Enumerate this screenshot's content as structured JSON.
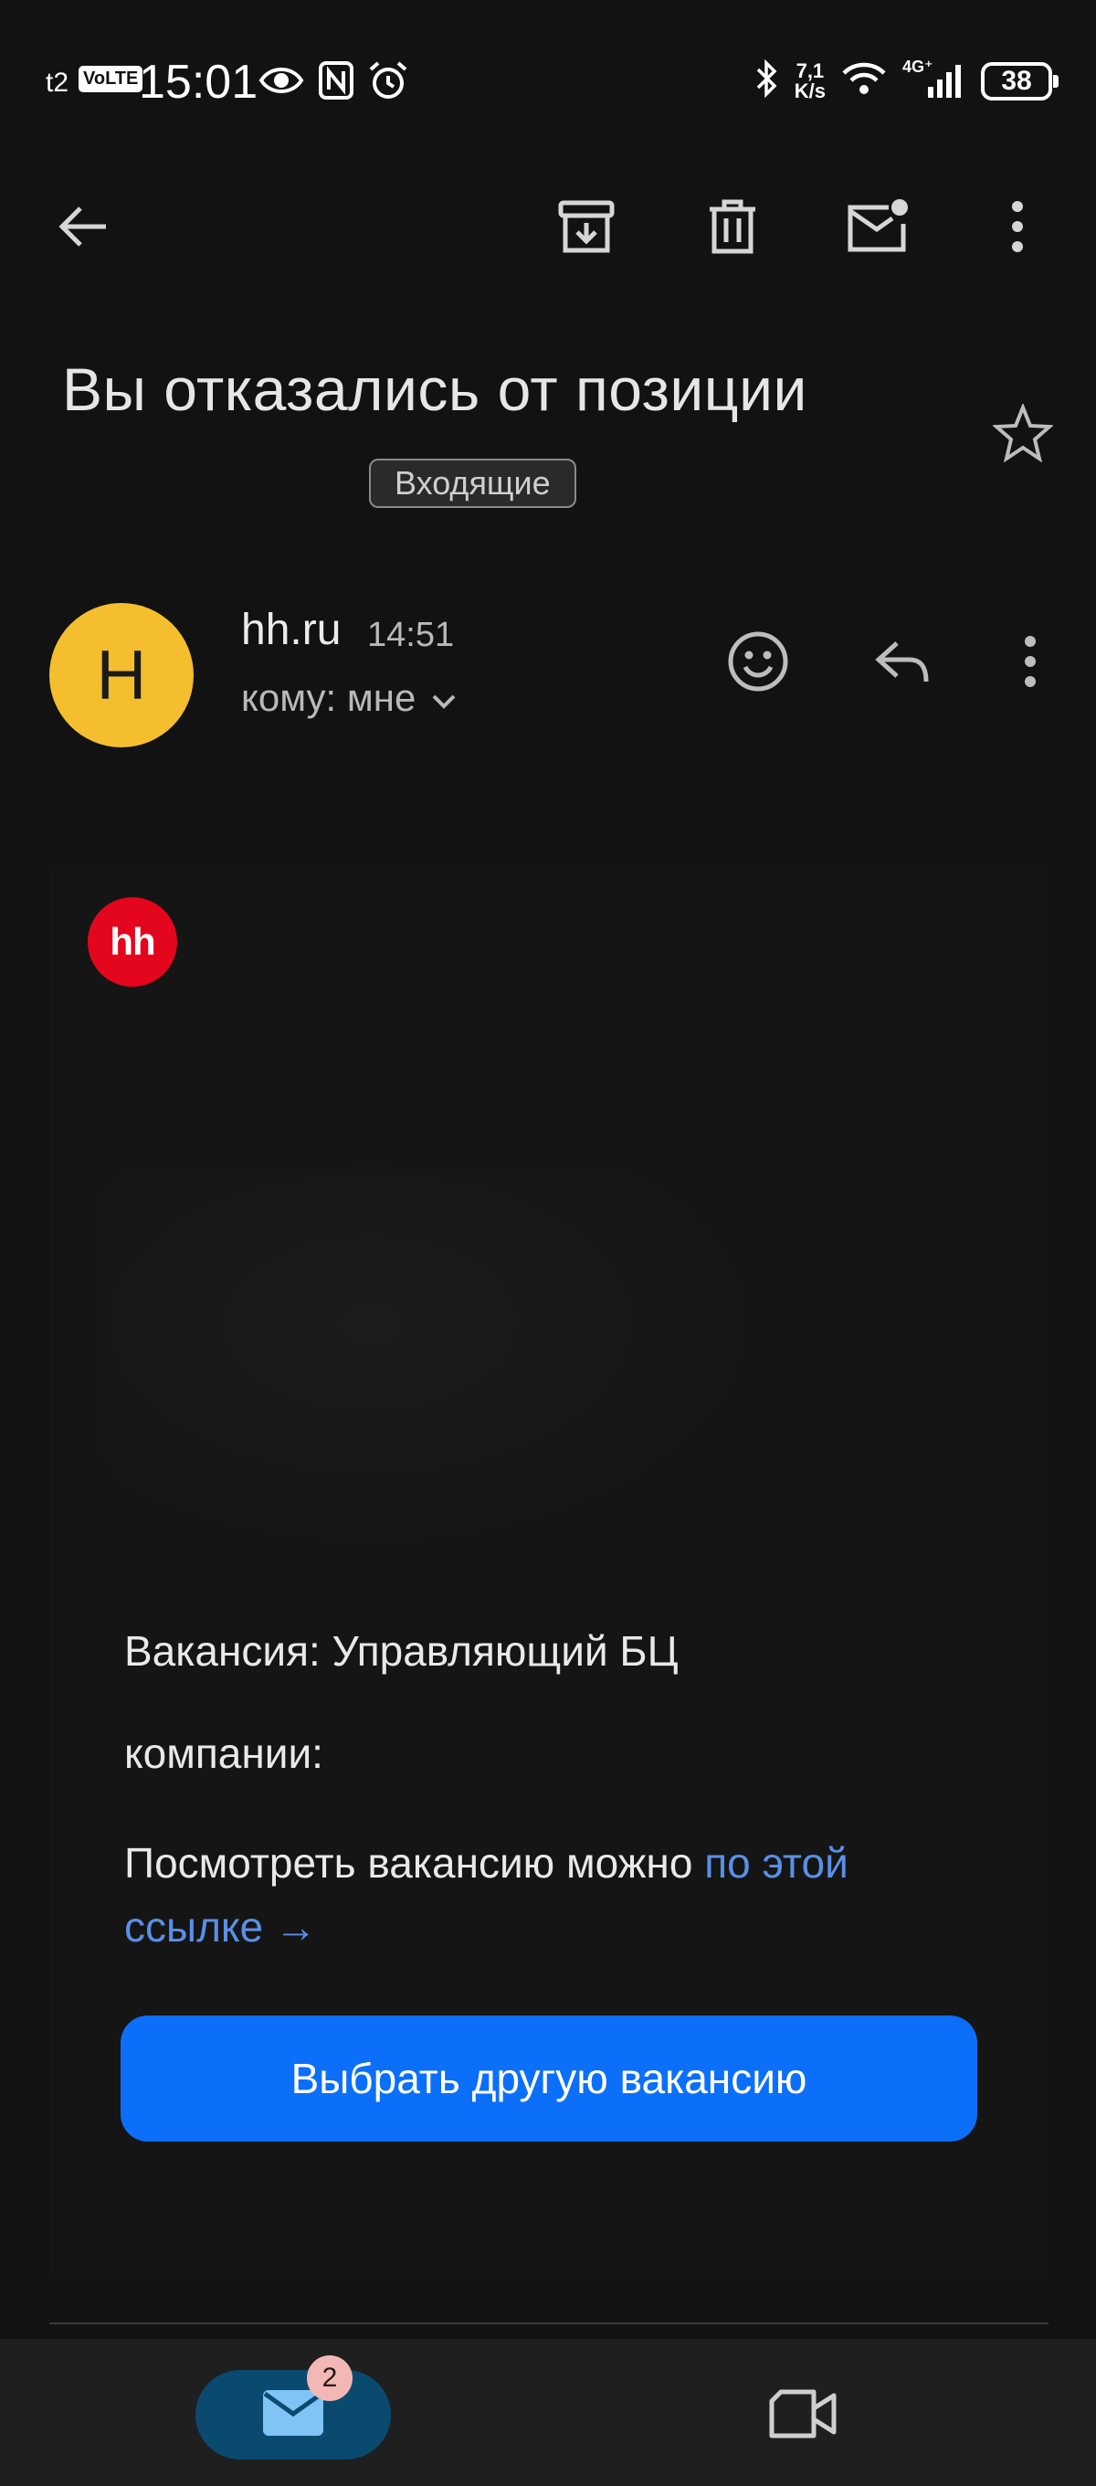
{
  "status_bar": {
    "carrier": "t2",
    "volte": "VoLTE",
    "time": "15:01",
    "speed_value": "7,1",
    "speed_unit": "K/s",
    "network": "4G⁺",
    "battery": "38"
  },
  "toolbar": {
    "back_icon": "arrow-back-icon",
    "archive_icon": "archive-icon",
    "delete_icon": "trash-icon",
    "mark_unread_icon": "mail-unread-icon",
    "more_icon": "more-vert-icon"
  },
  "email": {
    "subject": "Вы отказались от позиции",
    "label": "Входящие",
    "sender": {
      "initial": "H",
      "avatar_color": "#f4be2e",
      "name": "hh.ru",
      "time": "14:51",
      "recipient": "кому: мне"
    },
    "body": {
      "logo_text": "hh",
      "logo_color": "#e3061c",
      "vacancy_line": "Вакансия: Управляющий БЦ",
      "company_line": "компании:",
      "view_text": "Посмотреть вакансию можно",
      "view_link_part1": "по этой",
      "view_link_part2": "ссылке →",
      "button_label": "Выбрать другую вакансию",
      "button_color": "#0b6ffa"
    }
  },
  "bottom_nav": {
    "mail_badge": "2",
    "mail_icon": "mail-icon",
    "meet_icon": "video-camera-icon"
  }
}
